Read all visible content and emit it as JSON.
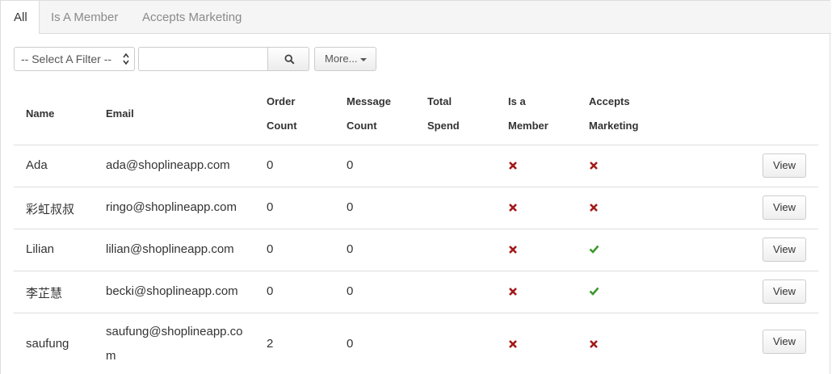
{
  "tabs": [
    {
      "label": "All",
      "active": true
    },
    {
      "label": "Is A Member",
      "active": false
    },
    {
      "label": "Accepts Marketing",
      "active": false
    }
  ],
  "filter": {
    "select_value": "-- Select A Filter --",
    "search_value": "",
    "search_icon": "search-icon",
    "more_label": "More..."
  },
  "table": {
    "headers": [
      {
        "line1": "Name",
        "line2": ""
      },
      {
        "line1": "Email",
        "line2": ""
      },
      {
        "line1": "Order",
        "line2": "Count"
      },
      {
        "line1": "Message",
        "line2": "Count"
      },
      {
        "line1": "Total",
        "line2": "Spend"
      },
      {
        "line1": "Is a",
        "line2": "Member"
      },
      {
        "line1": "Accepts",
        "line2": "Marketing"
      }
    ],
    "rows": [
      {
        "name": "Ada",
        "email": "ada@shoplineapp.com",
        "email2": "",
        "orders": "0",
        "messages": "0",
        "spend": "",
        "member": "no",
        "marketing": "no",
        "view": "View"
      },
      {
        "name": "彩虹叔叔",
        "email": "ringo@shoplineapp.com",
        "email2": "",
        "orders": "0",
        "messages": "0",
        "spend": "",
        "member": "no",
        "marketing": "no",
        "view": "View"
      },
      {
        "name": "Lilian",
        "email": "lilian@shoplineapp.com",
        "email2": "",
        "orders": "0",
        "messages": "0",
        "spend": "",
        "member": "no",
        "marketing": "yes",
        "view": "View"
      },
      {
        "name": "李芷慧",
        "email": "becki@shoplineapp.com",
        "email2": "",
        "orders": "0",
        "messages": "0",
        "spend": "",
        "member": "no",
        "marketing": "yes",
        "view": "View"
      },
      {
        "name": "saufung",
        "email": "saufung@shoplineapp.co",
        "email2": "m",
        "orders": "2",
        "messages": "0",
        "spend": "",
        "member": "no",
        "marketing": "no",
        "view": "View"
      }
    ]
  },
  "colors": {
    "no": "#a31a1a",
    "yes": "#3c9a2c"
  }
}
